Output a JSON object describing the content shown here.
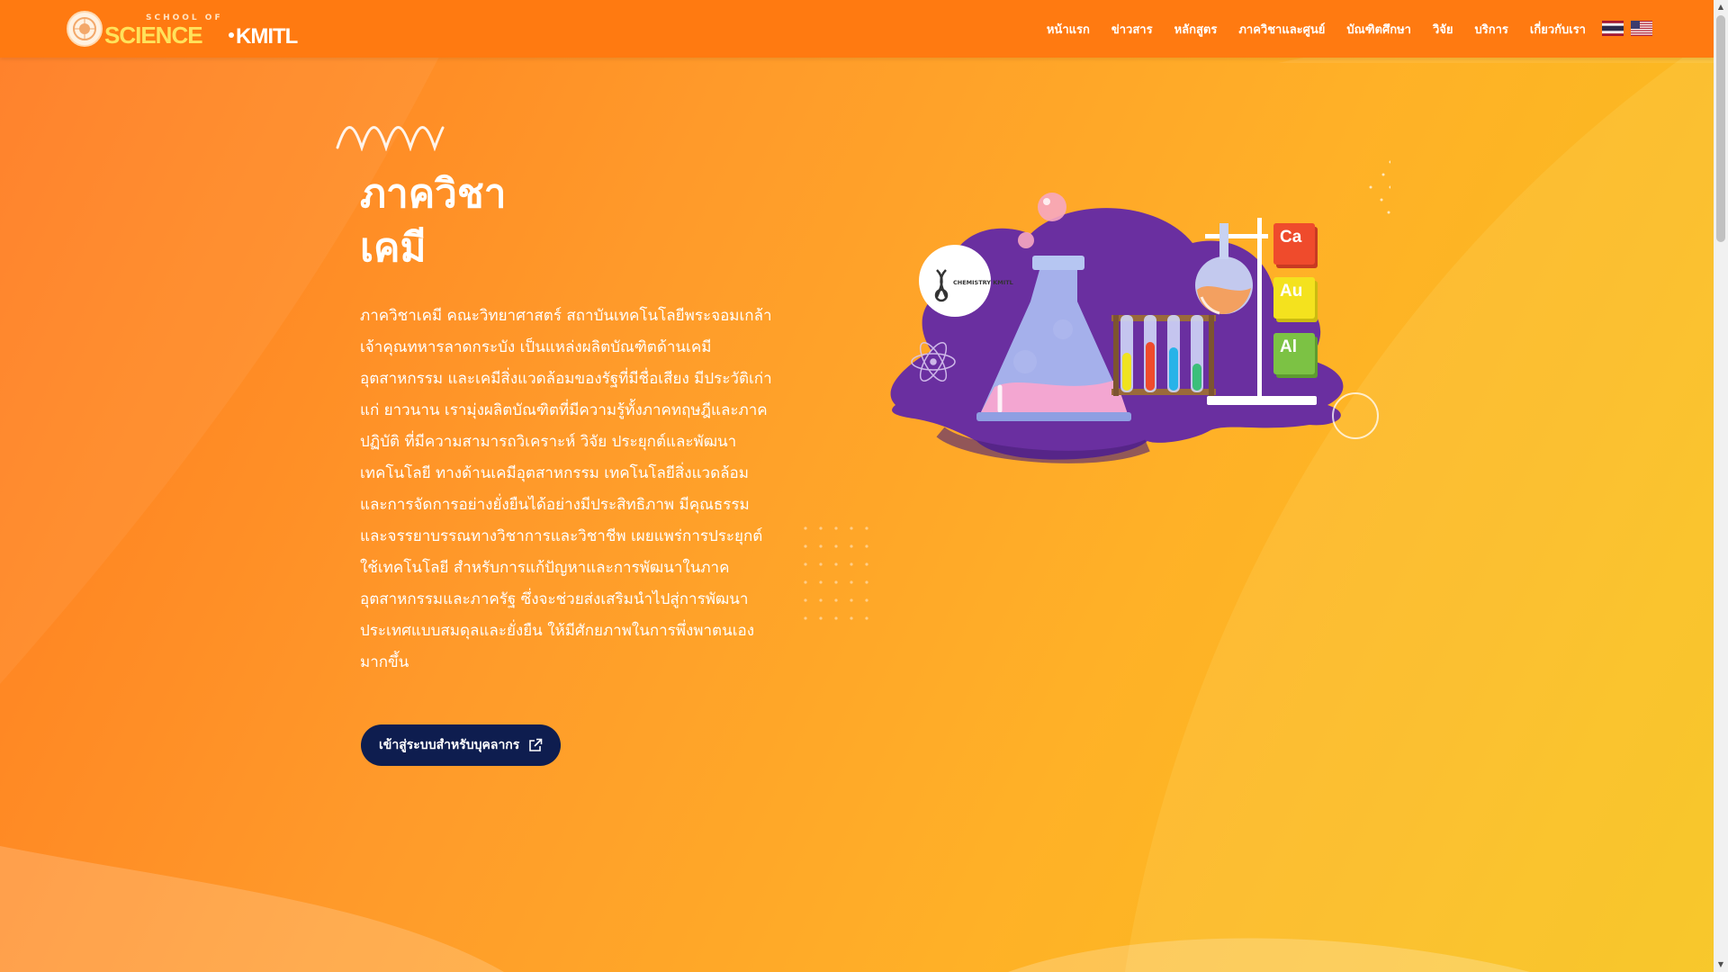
{
  "nav": {
    "logo": {
      "small": "SCHOOL OF",
      "main": "SCIENCE",
      "kmitl": "KMITL"
    },
    "items": [
      {
        "label": "หน้าแรก"
      },
      {
        "label": "ข่าวสาร"
      },
      {
        "label": "หลักสูตร"
      },
      {
        "label": "ภาควิชาและศูนย์"
      },
      {
        "label": "บัณฑิตศึกษา"
      },
      {
        "label": "วิจัย"
      },
      {
        "label": "บริการ"
      },
      {
        "label": "เกี่ยวกับเรา"
      }
    ],
    "languages": [
      {
        "icon": "thai-flag-icon"
      },
      {
        "icon": "us-flag-icon"
      }
    ]
  },
  "hero": {
    "title_line1": "ภาควิชา",
    "title_line2": "เคมี",
    "description": "ภาควิชาเคมี คณะวิทยาศาสตร์ สถาบันเทคโนโลยีพระจอมเกล้าเจ้าคุณทหารลาดกระบัง เป็นแหล่งผลิตบัณฑิตด้านเคมีอุตสาหกรรม และเคมีสิ่งแวดล้อมของรัฐที่มีชื่อเสียง มีประวัติเก่าแก่ ยาวนาน เรามุ่งผลิตบัณฑิตที่มีความรู้ทั้งภาคทฤษฎีและภาคปฏิบัติ ที่มีความสามารถวิเคราะห์ วิจัย ประยุกต์และพัฒนาเทคโนโลยี ทางด้านเคมีอุตสาหกรรม เทคโนโลยีสิ่งแวดล้อม และการจัดการอย่างยั่งยืนได้อย่างมีประสิทธิภาพ มีคุณธรรม และจรรยาบรรณทางวิชาการและวิชาชีพ เผยแพร่การประยุกต์ใช้เทคโนโลยี สำหรับการแก้ปัญหาและการพัฒนาในภาคอุตสาหกรรมและภาครัฐ ซึ่งจะช่วยส่งเสริมนำไปสู่การพัฒนาประเทศแบบสมดุลและยั่งยืน ให้มีศักยภาพในการพึ่งพาตนเองมากขึ้น",
    "cta_label": "เข้าสู่ระบบสำหรับบุคลากร",
    "cta_icon": "external-link-icon"
  },
  "illustration": {
    "badge_text": "CHEMISTRY KMITL",
    "elements": [
      "Ca",
      "Au",
      "Al"
    ]
  },
  "colors": {
    "nav_bg": "#ff7a11",
    "bg_start": "#ff7a1f",
    "bg_end": "#f6c21a",
    "cta_bg": "#0e1d4f",
    "purple": "#6a2fa0",
    "element_ca": "#ef4b2c",
    "element_au": "#f4e21e",
    "element_al": "#7cc244"
  }
}
